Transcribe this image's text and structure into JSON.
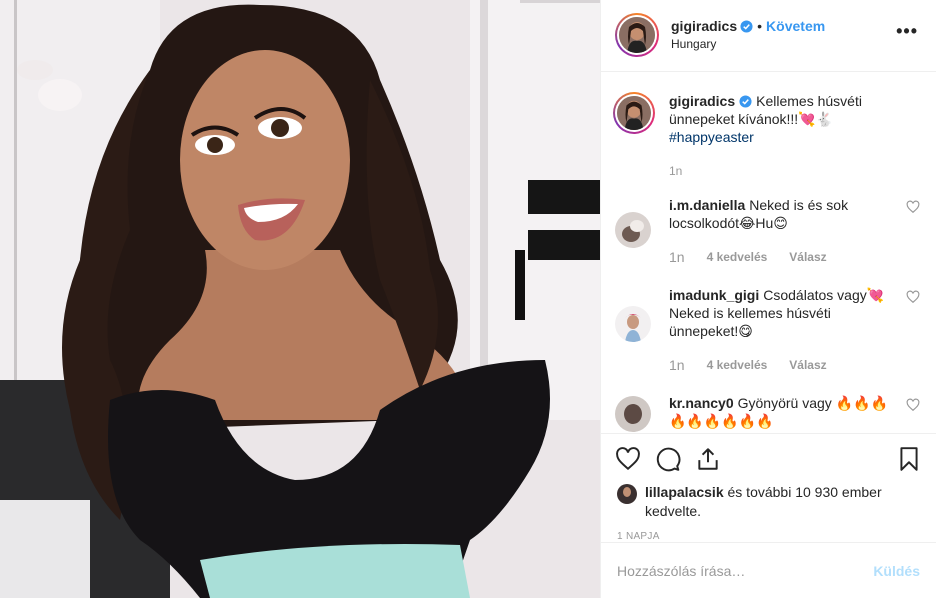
{
  "post": {
    "username": "gigiradics",
    "follow_label": "Követem",
    "dot": "•",
    "location": "Hungary",
    "more_label": "•••",
    "caption": {
      "username": "gigiradics",
      "text": "Kellemes húsvéti ünnepeket kívánok!!!💘🐇",
      "hashtag": "#happyeaster",
      "time": "1n"
    },
    "comments": [
      {
        "username": "i.m.daniella",
        "text": "Neked is és sok locsolkodót😂Hu😊",
        "time": "1n",
        "likes": "4 kedvelés",
        "reply": "Válasz"
      },
      {
        "username": "imadunk_gigi",
        "text": "Csodálatos vagy💘 Neked is kellemes húsvéti ünnepeket!😋",
        "time": "1n",
        "likes": "4 kedvelés",
        "reply": "Válasz"
      },
      {
        "username": "kr.nancy0",
        "text": "Gyönyörü vagy 🔥🔥🔥 🔥🔥🔥🔥🔥🔥",
        "time": "",
        "likes": "",
        "reply": ""
      }
    ],
    "liked_by": {
      "username": "lillapalacsik",
      "rest": "és további 10 930 ember kedvelte."
    },
    "date": "1 NAPJA",
    "comment_input": {
      "placeholder": "Hozzászólás írása…"
    },
    "post_button": "Küldés"
  },
  "colors": {
    "accent": "#3897f0",
    "hashtag": "#003569",
    "muted": "#999999",
    "post_disabled": "#b2dffc"
  },
  "icons": [
    "verified-icon",
    "more-options-icon",
    "heart-icon",
    "comment-icon",
    "share-icon",
    "bookmark-icon"
  ]
}
